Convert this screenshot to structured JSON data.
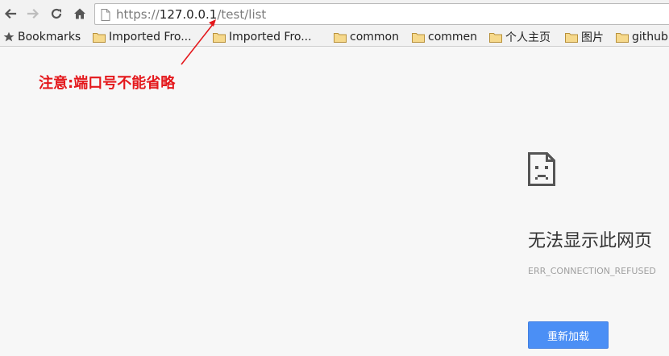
{
  "browser": {
    "address_bar": {
      "scheme": "https://",
      "host": "127.0.0.1",
      "path": "/test/list"
    }
  },
  "bookmarks_bar": {
    "label": "Bookmarks",
    "items": [
      {
        "label": "Imported Fro..."
      },
      {
        "label": "Imported Fro..."
      },
      {
        "label": "common"
      },
      {
        "label": "commen"
      },
      {
        "label": "个人主页"
      },
      {
        "label": "图片"
      },
      {
        "label": "github"
      }
    ]
  },
  "annotation": {
    "text": "注意:端口号不能省略",
    "color": "#e4181c"
  },
  "error_page": {
    "title": "无法显示此网页",
    "code": "ERR_CONNECTION_REFUSED",
    "reload_button": "重新加载",
    "accent": "#4b8ff5"
  },
  "icons": {
    "back": "back-arrow-icon",
    "forward": "forward-arrow-icon",
    "reload": "reload-icon",
    "home": "home-icon",
    "page": "page-icon",
    "star": "star-icon",
    "folder": "folder-icon",
    "sad_page": "sad-page-icon"
  }
}
